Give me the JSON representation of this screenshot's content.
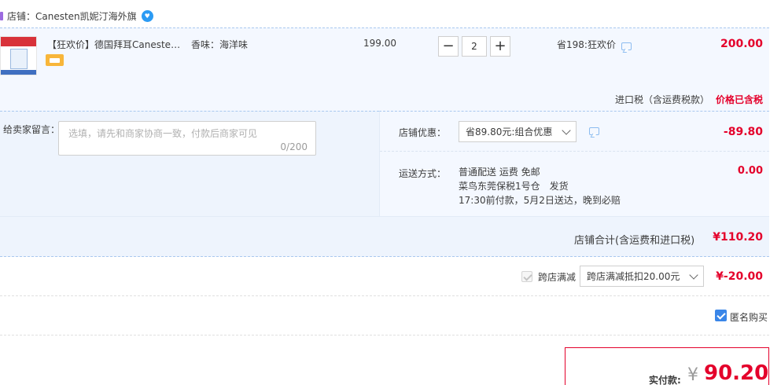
{
  "shop": {
    "name": "店铺：Canesten凯妮汀海外旗",
    "badge": "♥"
  },
  "item": {
    "title": "【狂欢价】德国拜耳Canesten凯妮汀洗液",
    "sku": "香味：海洋味",
    "unit_price": "199.00",
    "quantity": "2",
    "minus_label": "−",
    "plus_label": "+",
    "promo": "省198:狂欢价",
    "total": "200.00",
    "tax_label": "进口税（含运费税款）",
    "tax_value": "价格已含税"
  },
  "message": {
    "label": "给卖家留言：",
    "placeholder": "选填，请先和商家协商一致，付款后商家可见",
    "count": "0/200"
  },
  "shop_discount": {
    "label": "店铺优惠：",
    "selected": "省89.80元:组合优惠",
    "amount": "-89.80"
  },
  "shipping": {
    "label": "运送方式：",
    "line1": "普通配送 运费 免邮",
    "line2": "菜鸟东莞保税1号仓　发货",
    "line3": "17:30前付款，5月2日送达，晚到必赔",
    "amount": "0.00"
  },
  "subtotal": {
    "label": "店铺合计(含运费和进口税)",
    "value": "¥110.20"
  },
  "cross_store": {
    "label": "跨店满减",
    "selected": "跨店满减抵扣20.00元",
    "amount": "¥-20.00"
  },
  "anonymous": {
    "label": "匿名购买",
    "checked": true
  },
  "payment": {
    "label": "实付款:",
    "currency": "¥",
    "value": "90.20"
  },
  "colors": {
    "price_red": "#e4002b",
    "band_blue": "#f4f8ff",
    "checkbox_blue": "#3a86e8"
  }
}
